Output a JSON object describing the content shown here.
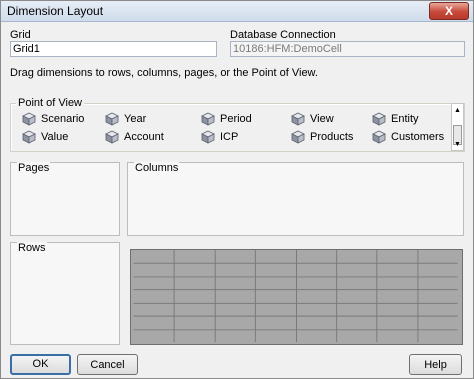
{
  "window": {
    "title": "Dimension Layout",
    "close_label": "X"
  },
  "grid_field": {
    "label": "Grid",
    "value": "Grid1"
  },
  "db_field": {
    "label": "Database Connection",
    "value": "10186:HFM:DemoCell"
  },
  "instruction": "Drag dimensions to rows, columns, pages, or the Point of View.",
  "pov": {
    "label": "Point of View",
    "items": [
      {
        "label": "Scenario",
        "icon": "dimension-icon"
      },
      {
        "label": "Year",
        "icon": "dimension-icon"
      },
      {
        "label": "Period",
        "icon": "dimension-icon"
      },
      {
        "label": "View",
        "icon": "dimension-icon"
      },
      {
        "label": "Entity",
        "icon": "dimension-icon"
      },
      {
        "label": "Value",
        "icon": "dimension-icon"
      },
      {
        "label": "Account",
        "icon": "dimension-icon"
      },
      {
        "label": "ICP",
        "icon": "dimension-icon"
      },
      {
        "label": "Products",
        "icon": "dimension-icon"
      },
      {
        "label": "Customers",
        "icon": "dimension-icon"
      }
    ]
  },
  "pages": {
    "label": "Pages"
  },
  "columns": {
    "label": "Columns"
  },
  "rows": {
    "label": "Rows"
  },
  "buttons": {
    "ok": "OK",
    "cancel": "Cancel",
    "help": "Help"
  },
  "colors": {
    "titlebar": "#d6e1ef",
    "grid_fill": "#a8a8a8",
    "close": "#c7493a"
  }
}
